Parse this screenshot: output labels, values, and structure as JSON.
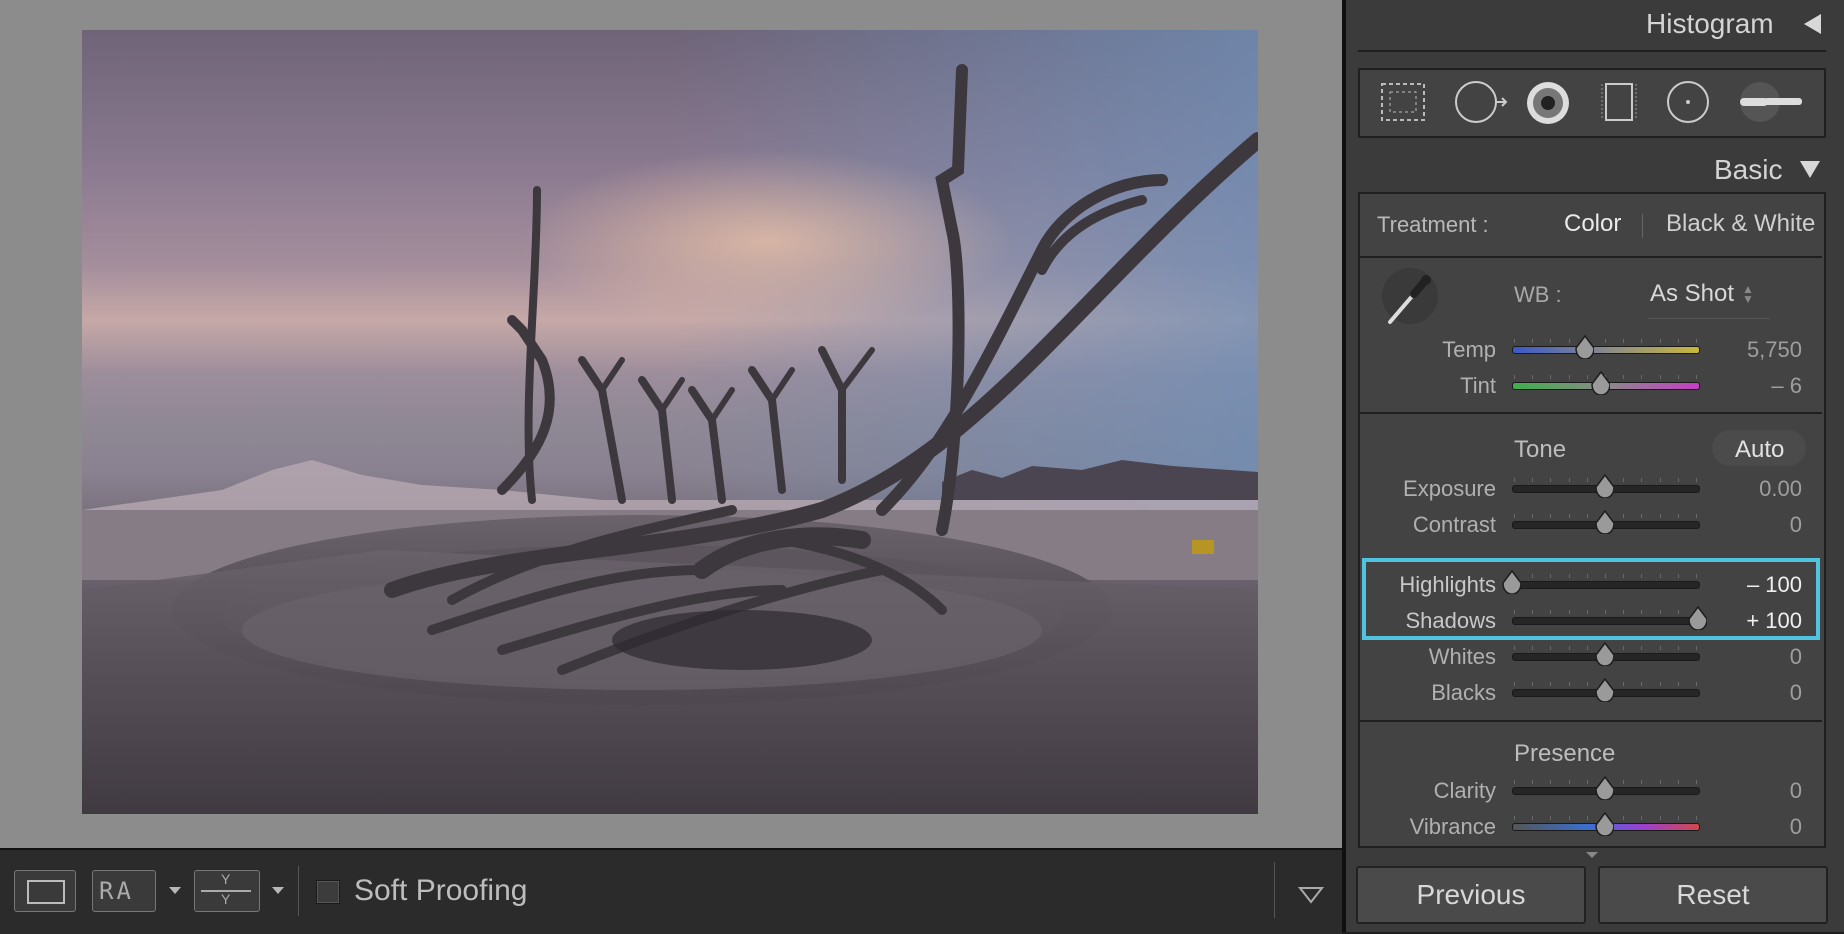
{
  "panel": {
    "histogram_label": "Histogram",
    "basic_label": "Basic",
    "treatment": {
      "label": "Treatment :",
      "options": [
        "Color",
        "Black & White"
      ],
      "selected": "Color"
    },
    "wb": {
      "label": "WB :",
      "value": "As Shot"
    },
    "sliders_wb": [
      {
        "label": "Temp",
        "value": "5,750",
        "position": 0.39
      },
      {
        "label": "Tint",
        "value": "– 6",
        "position": 0.48
      }
    ],
    "tone": {
      "title": "Tone",
      "auto_label": "Auto"
    },
    "sliders_tone": [
      {
        "label": "Exposure",
        "value": "0.00",
        "position": 0.5
      },
      {
        "label": "Contrast",
        "value": "0",
        "position": 0.5
      }
    ],
    "sliders_highlighted": [
      {
        "label": "Highlights",
        "value": "– 100",
        "position": 0.0
      },
      {
        "label": "Shadows",
        "value": "+ 100",
        "position": 1.0
      }
    ],
    "sliders_tone2": [
      {
        "label": "Whites",
        "value": "0",
        "position": 0.5
      },
      {
        "label": "Blacks",
        "value": "0",
        "position": 0.5
      }
    ],
    "presence": {
      "title": "Presence"
    },
    "sliders_presence": [
      {
        "label": "Clarity",
        "value": "0",
        "position": 0.5
      },
      {
        "label": "Vibrance",
        "value": "0",
        "position": 0.5
      }
    ],
    "previous_label": "Previous",
    "reset_label": "Reset",
    "tools": [
      "crop-overlay-icon",
      "spot-removal-icon",
      "red-eye-icon",
      "graduated-filter-icon",
      "radial-filter-icon",
      "adjustment-brush-icon"
    ]
  },
  "toolbar": {
    "soft_proofing_label": "Soft Proofing",
    "soft_proofing_checked": false
  },
  "colors": {
    "highlight": "#4fc3e0",
    "panel_bg": "#3b3b3b",
    "viewer_bg": "#8c8c8c"
  }
}
